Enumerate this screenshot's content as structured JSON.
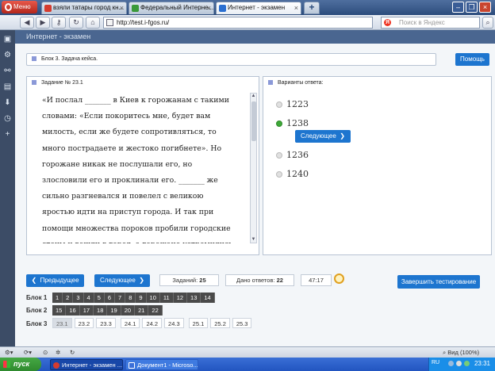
{
  "browser": {
    "menu_label": "Меню",
    "tabs": [
      {
        "label": "взяли татары город кн...",
        "active": false,
        "icon_color": "#d63b2e"
      },
      {
        "label": "Федеральный Интерне...",
        "active": false,
        "icon_color": "#3a9a3a"
      },
      {
        "label": "Интернет - экзамен",
        "active": true,
        "icon_color": "#2a6fd1"
      }
    ],
    "new_tab": "+",
    "url": "http://test.i-fgos.ru/",
    "search_placeholder": "Поиск в Яндекс",
    "search_engine_letter": "Я"
  },
  "app": {
    "title": "Интернет - экзамен",
    "block_label": "Блок 3. Задача кейса.",
    "help_label": "Помощь",
    "task_label": "Задание № 23.1",
    "task_text": "«И послал _______ в Киев к горожанам с такими словами: «Если покоритесь мне, будет вам милость, если же будете сопротивляться, то много пострадаете и жестоко погибнете». Но горожане никак не послушали его, но злословили его и проклинали его. _______ же сильно разгневался и повелел с великою яростью идти на приступ города. И так при помощи множества пороков пробили городские стены и вошли в город, а горожане устремились навстречу им. И тут можно было видеть и слышать страшный треск копий и",
    "answers_label": "Варианты ответа:",
    "options": [
      {
        "label": "1223",
        "selected": false
      },
      {
        "label": "1238",
        "selected": true
      },
      {
        "label": "1236",
        "selected": false
      },
      {
        "label": "1240",
        "selected": false
      }
    ],
    "next_inline": "Следующее",
    "prev_button": "Предыдущее",
    "next_button": "Следующее",
    "tasks_count_label": "Заданий:",
    "tasks_count": "25",
    "answered_label": "Дано ответов:",
    "answered_count": "22",
    "timer": "47:17",
    "finish_button": "Завершить тестирование",
    "blocks": [
      {
        "label": "Блок 1",
        "items": [
          "1",
          "2",
          "3",
          "4",
          "5",
          "6",
          "7",
          "8",
          "9",
          "10",
          "11",
          "12",
          "13",
          "14"
        ]
      },
      {
        "label": "Блок 2",
        "items": [
          "15",
          "16",
          "17",
          "18",
          "19",
          "20",
          "21",
          "22"
        ]
      },
      {
        "label": "Блок 3",
        "items": [
          "23.1",
          "23.2",
          "23.3",
          "24.1",
          "24.2",
          "24.3",
          "25.1",
          "25.2",
          "25.3"
        ]
      }
    ]
  },
  "status": {
    "zoom": "Вид (100%)"
  },
  "taskbar": {
    "start": "пуск",
    "tasks": [
      {
        "label": "Интернет - экзамен ...",
        "icon_color": "#d63b2e"
      },
      {
        "label": "Документ1 - Microso...",
        "icon_color": "#3b6fd8"
      }
    ],
    "lang": "RU",
    "clock": "23:31"
  }
}
